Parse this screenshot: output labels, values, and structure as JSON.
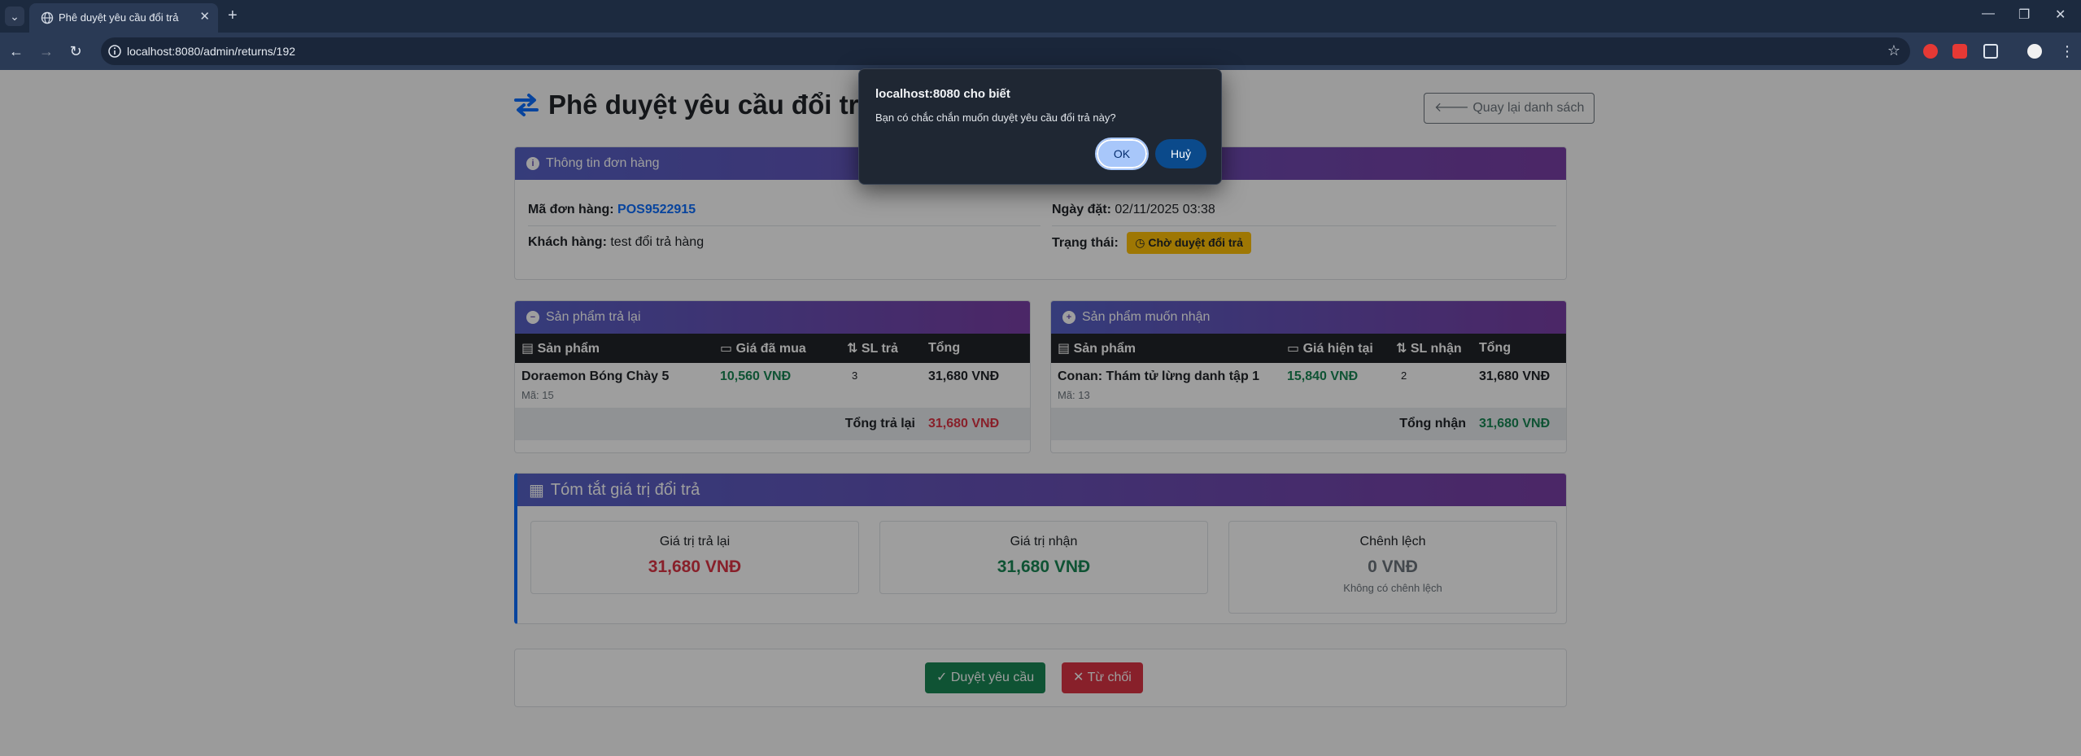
{
  "browser": {
    "tab_title": "Phê duyệt yêu cầu đổi trả",
    "url": "localhost:8080/admin/returns/192"
  },
  "page": {
    "title": "Phê duyệt yêu cầu đổi trả",
    "back_button": "Quay lại danh sách"
  },
  "order_info": {
    "header": "Thông tin đơn hàng",
    "order_code_label": "Mã đơn hàng:",
    "order_code": "POS9522915",
    "order_date_label": "Ngày đặt:",
    "order_date": "02/11/2025 03:38",
    "customer_label": "Khách hàng:",
    "customer": "test đổi trả hàng",
    "status_label": "Trạng thái:",
    "status": "Chờ duyệt đổi trả"
  },
  "return_products": {
    "header": "Sản phẩm trả lại",
    "columns": [
      "Sản phẩm",
      "Giá đã mua",
      "SL trả",
      "Tổng"
    ],
    "rows": [
      {
        "name": "Doraemon Bóng Chày 5",
        "code": "Mã: 15",
        "price": "10,560 VNĐ",
        "qty": "3",
        "total": "31,680 VNĐ"
      }
    ],
    "total_label": "Tổng trả lại",
    "total_value": "31,680 VNĐ"
  },
  "receive_products": {
    "header": "Sản phẩm muốn nhận",
    "columns": [
      "Sản phẩm",
      "Giá hiện tại",
      "SL nhận",
      "Tổng"
    ],
    "rows": [
      {
        "name": "Conan: Thám tử lừng danh tập 1",
        "code": "Mã: 13",
        "price": "15,840 VNĐ",
        "qty": "2",
        "total": "31,680 VNĐ"
      }
    ],
    "total_label": "Tổng nhận",
    "total_value": "31,680 VNĐ"
  },
  "summary": {
    "header": "Tóm tắt giá trị đổi trả",
    "return_label": "Giá trị trả lại",
    "return_value": "31,680 VNĐ",
    "receive_label": "Giá trị nhận",
    "receive_value": "31,680 VNĐ",
    "diff_label": "Chênh lệch",
    "diff_value": "0 VNĐ",
    "diff_note": "Không có chênh lệch"
  },
  "actions": {
    "approve": "Duyệt yêu cầu",
    "reject": "Từ chối"
  },
  "dialog": {
    "title": "localhost:8080 cho biết",
    "message": "Bạn có chắc chắn muốn duyệt yêu cầu đổi trả này?",
    "ok": "OK",
    "cancel": "Huỷ"
  },
  "colors": {
    "header_gradient_start": "#5661c6",
    "header_gradient_end": "#7a3fa6",
    "success": "#198754",
    "danger": "#dc3545",
    "warning": "#ffc107",
    "primary": "#0d6efd"
  },
  "icons": [
    "exchange-arrows-icon",
    "arrow-left-icon",
    "info-circle-icon",
    "minus-circle-icon",
    "plus-circle-icon",
    "box-icon",
    "money-icon",
    "sort-icon",
    "calculator-icon",
    "check-icon",
    "times-icon",
    "clock-icon"
  ]
}
